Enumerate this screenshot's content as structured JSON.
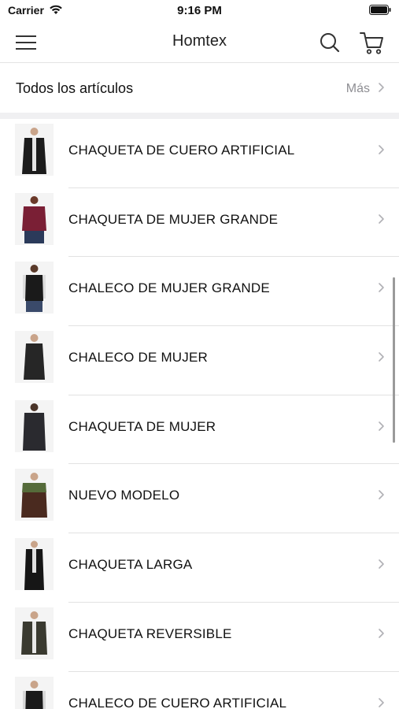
{
  "status_bar": {
    "carrier": "Carrier",
    "time": "9:16 PM",
    "wifi_icon": "wifi-icon",
    "battery_icon": "battery-icon"
  },
  "navbar": {
    "title": "Homtex",
    "menu_icon": "menu-icon",
    "search_icon": "search-icon",
    "cart_icon": "cart-icon"
  },
  "section": {
    "title": "Todos los artículos",
    "more_label": "Más"
  },
  "items": [
    {
      "label": "CHAQUETA DE CUERO ARTIFICIAL",
      "thumb": "black-jacket",
      "color": "#1c1c1c"
    },
    {
      "label": "CHAQUETA DE MUJER GRANDE",
      "thumb": "burgundy-jacket",
      "color": "#7a1f35"
    },
    {
      "label": "CHALECO DE MUJER GRANDE",
      "thumb": "black-vest",
      "color": "#1a1a1a"
    },
    {
      "label": "CHALECO DE MUJER",
      "thumb": "black-long-vest",
      "color": "#262626"
    },
    {
      "label": "CHAQUETA DE MUJER",
      "thumb": "black-long-jacket",
      "color": "#2a2a2f"
    },
    {
      "label": "NUEVO MODELO",
      "thumb": "olive-brown-jacket",
      "color": "#4a2a1f"
    },
    {
      "label": "CHAQUETA LARGA",
      "thumb": "black-long-coat",
      "color": "#161616"
    },
    {
      "label": "CHAQUETA REVERSIBLE",
      "thumb": "olive-jacket",
      "color": "#3a3a30"
    },
    {
      "label": "CHALECO DE CUERO ARTIFICIAL",
      "thumb": "black-leather-vest",
      "color": "#1a1a1a"
    }
  ]
}
